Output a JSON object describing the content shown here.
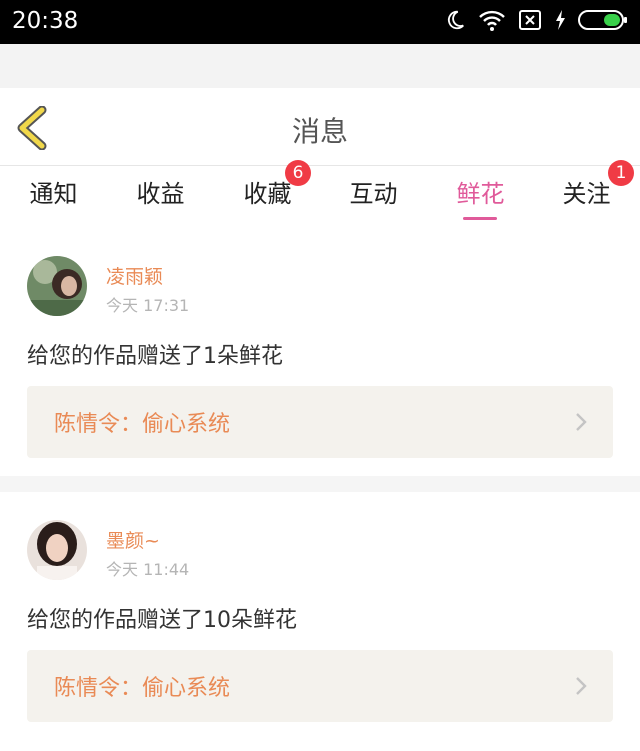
{
  "status_bar": {
    "time": "20:38"
  },
  "header": {
    "title": "消息"
  },
  "tabs": [
    {
      "label": "通知",
      "badge": ""
    },
    {
      "label": "收益",
      "badge": ""
    },
    {
      "label": "收藏",
      "badge": "6"
    },
    {
      "label": "互动",
      "badge": ""
    },
    {
      "label": "鲜花",
      "badge": "",
      "active": true
    },
    {
      "label": "关注",
      "badge": "1"
    }
  ],
  "messages": [
    {
      "username": "凌雨颖",
      "time": "今天 17:31",
      "text": "给您的作品赠送了1朵鲜花",
      "work_title": "陈情令：偷心系统"
    },
    {
      "username": "墨颜~",
      "time": "今天 11:44",
      "text": "给您的作品赠送了10朵鲜花",
      "work_title": "陈情令：偷心系统"
    }
  ],
  "colors": {
    "accent_pink": "#e05a9a",
    "username_orange": "#e98a55",
    "badge_red": "#f03b45",
    "back_arrow_yellow": "#f1d84a"
  },
  "icons": [
    "moon-icon",
    "wifi-icon",
    "no-sim-icon",
    "charging-icon",
    "battery-icon",
    "back-arrow-icon",
    "chevron-right-icon"
  ]
}
